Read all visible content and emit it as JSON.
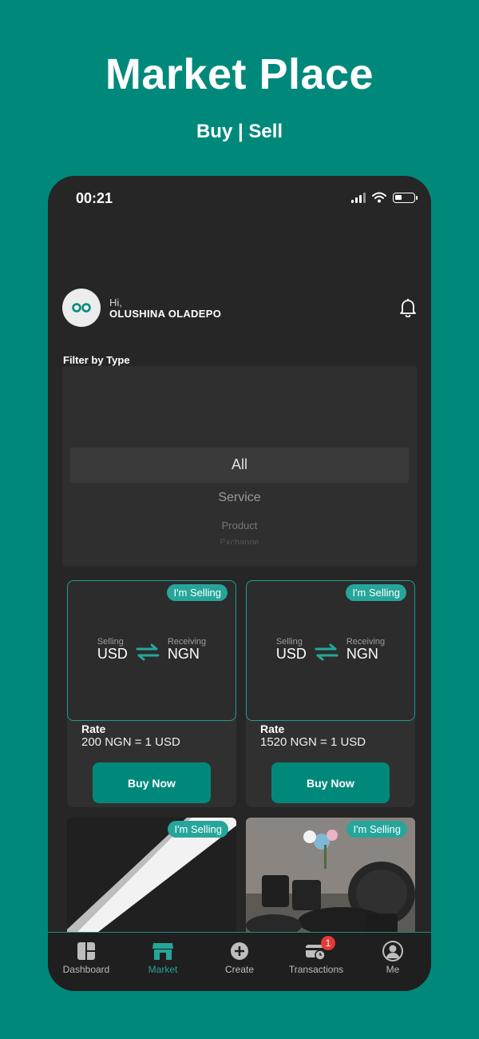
{
  "promo": {
    "title": "Market Place",
    "subtitle": "Buy | Sell"
  },
  "status": {
    "time": "00:21"
  },
  "user": {
    "greeting": "Hi,",
    "name": "OLUSHINA OLADEPO",
    "avatar_initials": "oo"
  },
  "filter": {
    "label": "Filter by Type",
    "options": [
      "All",
      "Service",
      "Product",
      "Exchange"
    ],
    "selected": "All"
  },
  "listings": [
    {
      "badge": "I'm Selling",
      "selling_label": "Selling",
      "selling": "USD",
      "receiving_label": "Receiving",
      "receiving": "NGN",
      "rate_label": "Rate",
      "rate": "200 NGN = 1 USD",
      "button": "Buy Now"
    },
    {
      "badge": "I'm Selling",
      "selling_label": "Selling",
      "selling": "USD",
      "receiving_label": "Receiving",
      "receiving": "NGN",
      "rate_label": "Rate",
      "rate": "1520 NGN = 1 USD",
      "button": "Buy Now"
    },
    {
      "badge": "I'm Selling"
    },
    {
      "badge": "I'm Selling"
    }
  ],
  "tabs": [
    {
      "label": "Dashboard",
      "icon": "dashboard-icon"
    },
    {
      "label": "Market",
      "icon": "market-icon",
      "active": true
    },
    {
      "label": "Create",
      "icon": "plus-circle-icon"
    },
    {
      "label": "Transactions",
      "icon": "transactions-icon",
      "badge": "1"
    },
    {
      "label": "Me",
      "icon": "user-icon"
    }
  ],
  "colors": {
    "brand": "#00897B",
    "accent": "#26A69A",
    "surface": "#262626",
    "badge_red": "#E53935"
  }
}
